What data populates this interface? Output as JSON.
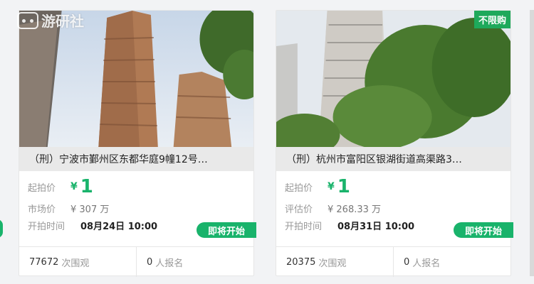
{
  "watermark": {
    "text": "游研社"
  },
  "listings": [
    {
      "title": "（刑）宁波市鄞州区东都华庭9幢12号…",
      "badge": "",
      "price_label": "起拍价",
      "currency": "¥",
      "price": "1",
      "value_label": "市场价",
      "value": "¥ 307 万",
      "time_label": "开拍时间",
      "time": "08月24日 10:00",
      "status_button": "即将开始",
      "views": "77672",
      "views_label": "次围观",
      "signups": "0",
      "signups_label": "人报名"
    },
    {
      "title": "（刑）杭州市富阳区银湖街道高渠路3…",
      "badge": "不限购",
      "price_label": "起拍价",
      "currency": "¥",
      "price": "1",
      "value_label": "评估价",
      "value": "¥ 268.33 万",
      "time_label": "开拍时间",
      "time": "08月31日 10:00",
      "status_button": "即将开始",
      "views": "20375",
      "views_label": "次围观",
      "signups": "0",
      "signups_label": "人报名"
    }
  ],
  "colors": {
    "accent": "#19b36b"
  }
}
